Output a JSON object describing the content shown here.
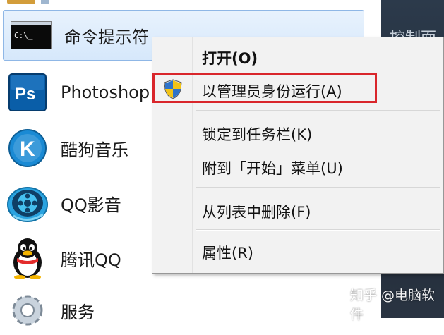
{
  "programs": [
    {
      "label": "命令提示符",
      "icon": "cmd-icon",
      "selected": true
    },
    {
      "label": "Photoshop",
      "icon": "photoshop-icon"
    },
    {
      "label": "酷狗音乐",
      "icon": "kugou-icon"
    },
    {
      "label": "QQ影音",
      "icon": "qqplayer-icon"
    },
    {
      "label": "腾讯QQ",
      "icon": "qq-penguin-icon"
    },
    {
      "label": "服务",
      "icon": "services-gear-icon"
    }
  ],
  "cmd_icon_text": "C:\\_",
  "photoshop_icon_text": "Ps",
  "kugou_icon_text": "K",
  "right_strip_text": "控制面",
  "context_menu": {
    "items": [
      {
        "label": "打开(O)",
        "bold": true
      },
      {
        "label": "以管理员身份运行(A)",
        "icon": "uac-shield-icon",
        "highlighted": true
      },
      {
        "label": "锁定到任务栏(K)"
      },
      {
        "label": "附到「开始」菜单(U)"
      },
      {
        "label": "从列表中删除(F)"
      },
      {
        "label": "属性(R)"
      }
    ]
  },
  "watermark": "知乎 @电脑软件",
  "colors": {
    "highlight_border": "#d9262b",
    "selected_bg": "#d6e8fb",
    "photoshop_blue": "#0a5ea8",
    "kugou_blue": "#1a8ad4"
  }
}
